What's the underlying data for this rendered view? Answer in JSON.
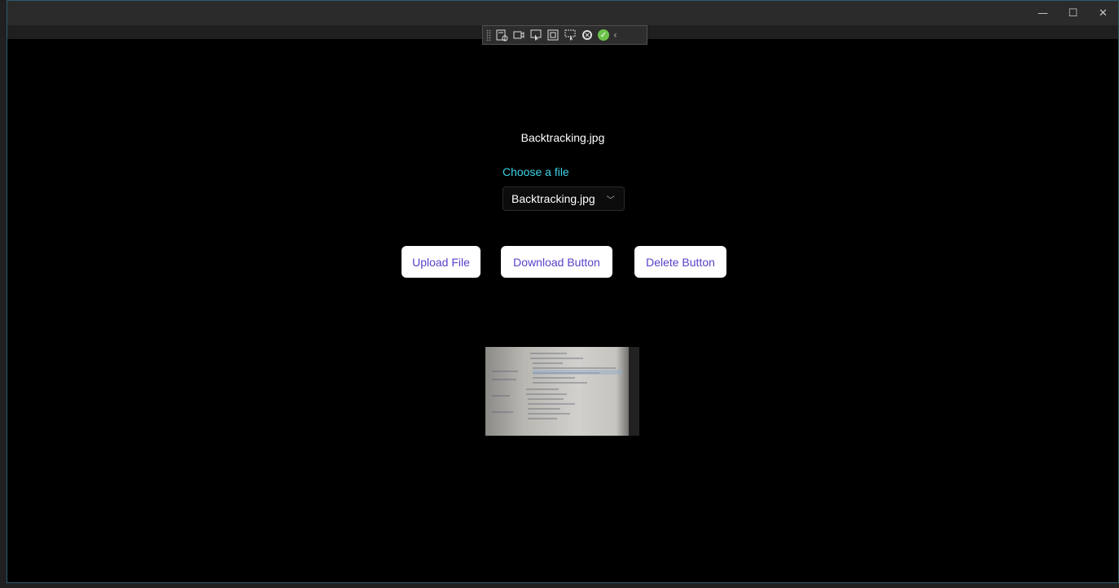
{
  "window": {
    "controls": {
      "minimize": "—",
      "maximize": "☐",
      "close": "✕"
    }
  },
  "devtools": {
    "icons": [
      "layout-icon",
      "camera-icon",
      "select-element-icon",
      "frame-icon",
      "inspect-icon",
      "hot-reload-icon",
      "check-icon",
      "collapse-chevron-icon"
    ]
  },
  "main": {
    "file_name": "Backtracking.jpg",
    "choose_label": "Choose a file",
    "select": {
      "value": "Backtracking.jpg"
    },
    "buttons": {
      "upload": "Upload File",
      "download": "Download Button",
      "delete": "Delete Button"
    }
  },
  "colors": {
    "accent_label": "#3cd3e6",
    "button_text": "#5b3fc9",
    "window_border": "#2a5a70"
  }
}
